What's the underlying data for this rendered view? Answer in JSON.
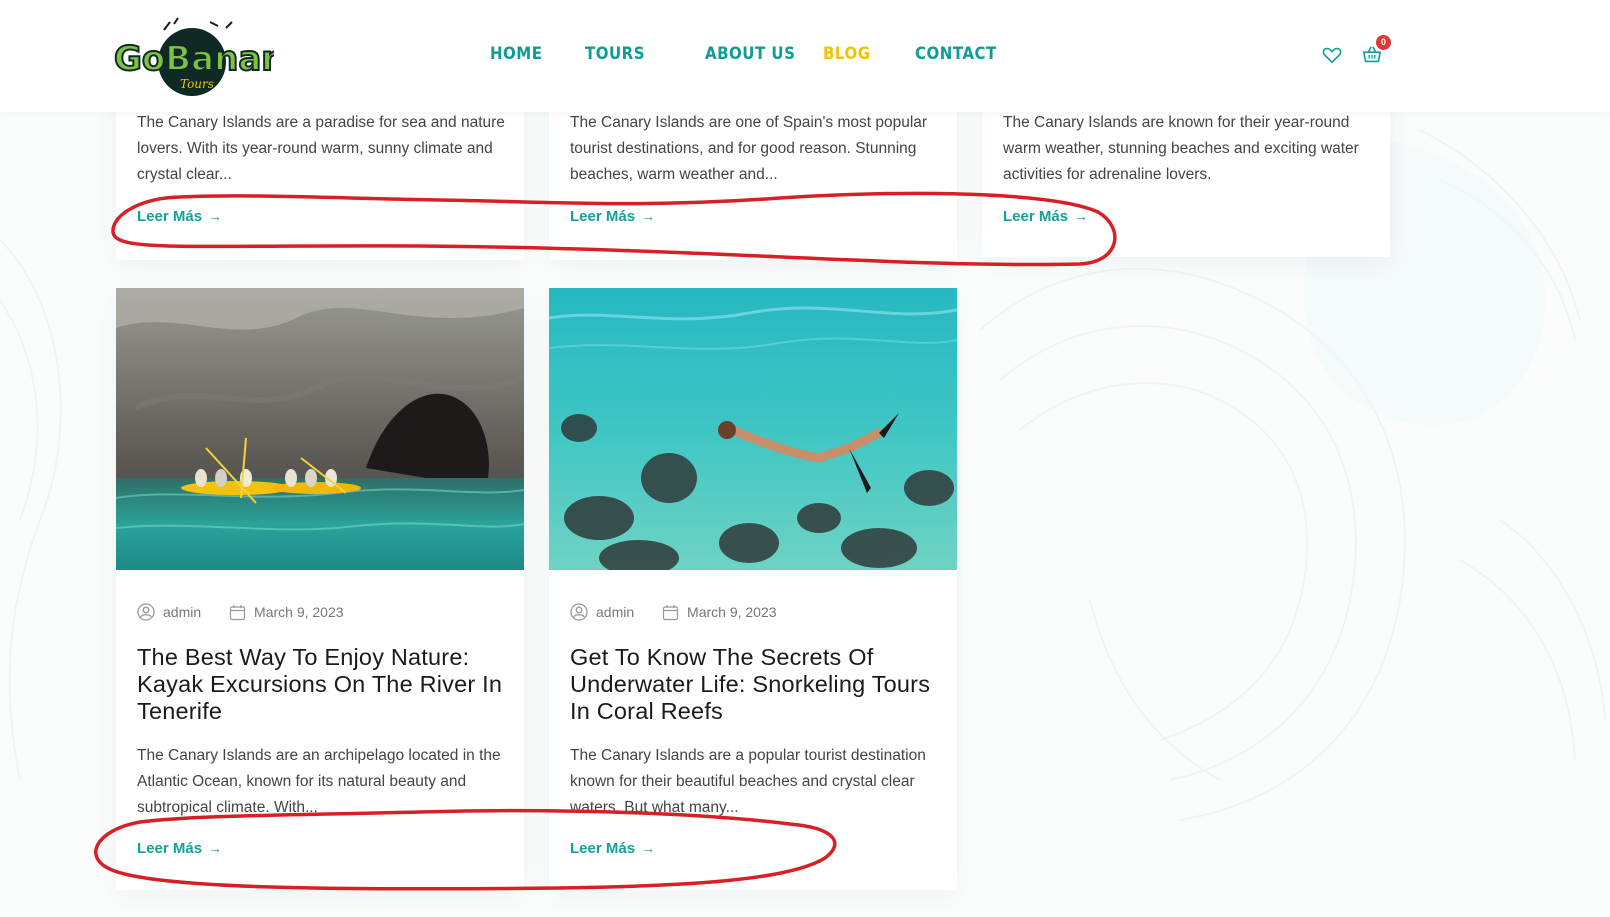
{
  "brand": {
    "logo_text": "GoBananas",
    "logo_sub": "Tours"
  },
  "nav": {
    "items": [
      {
        "label": "HOME"
      },
      {
        "label": "TOURS"
      },
      {
        "label": "ABOUT US"
      },
      {
        "label": "BLOG",
        "active": true
      },
      {
        "label": "CONTACT"
      }
    ]
  },
  "header_icons": {
    "wishlist": "heart-icon",
    "cart": "basket-icon",
    "cart_count": "0"
  },
  "colors": {
    "accent": "#13a19a",
    "active_nav": "#f3c200",
    "badge": "#e03636",
    "annotation": "#d81f26"
  },
  "posts_top": [
    {
      "excerpt": "The Canary Islands are a paradise for sea and nature lovers. With its year-round warm, sunny climate and crystal clear...",
      "read_more": "Leer Más"
    },
    {
      "excerpt": "The Canary Islands are one of Spain's most popular tourist destinations, and for good reason. Stunning beaches, warm weather and...",
      "read_more": "Leer Más"
    },
    {
      "excerpt": "The Canary Islands are known for their year-round warm weather, stunning beaches and exciting water activities for adrenaline lovers.",
      "read_more": "Leer Más"
    }
  ],
  "posts_bottom": [
    {
      "author": "admin",
      "date": "March 9, 2023",
      "title": "The Best Way To Enjoy Nature: Kayak Excursions On The River In Tenerife",
      "excerpt": "The Canary Islands are an archipelago located in the Atlantic Ocean, known for its natural beauty and subtropical climate. With...",
      "read_more": "Leer Más",
      "image": "kayak-cave-photo"
    },
    {
      "author": "admin",
      "date": "March 9, 2023",
      "title": "Get To Know The Secrets Of Underwater Life: Snorkeling Tours In Coral Reefs",
      "excerpt": "The Canary Islands are a popular tourist destination known for their beautiful beaches and crystal clear waters. But what many...",
      "read_more": "Leer Más",
      "image": "snorkeling-reef-photo"
    }
  ]
}
